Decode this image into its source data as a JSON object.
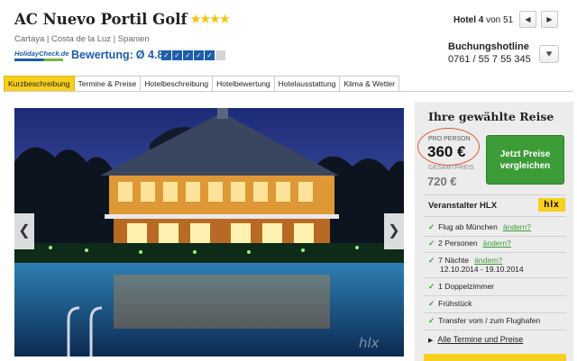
{
  "hotel": {
    "name": "AC Nuevo Portil Golf",
    "stars": "★★★★",
    "location": "Cartaya | Costa de la Luz | Spanien"
  },
  "rating": {
    "logo_text": "HolidayCheck.de",
    "label": "Bewertung:",
    "value": "Ø 4.8",
    "boxes_filled": 5,
    "boxes_total": 6
  },
  "pager": {
    "hotel_label": "Hotel",
    "current": "4",
    "separator": "von",
    "total": "51",
    "prev_icon": "◀",
    "next_icon": "▶"
  },
  "hotline": {
    "label": "Buchungshotline",
    "number": "0761 / 55 7 55 345",
    "favorite_icon": "♥"
  },
  "tabs": [
    {
      "label": "Kurzbeschreibung",
      "active": true
    },
    {
      "label": "Termine & Preise",
      "active": false
    },
    {
      "label": "Hotelbeschreibung",
      "active": false
    },
    {
      "label": "Hotelbewertung",
      "active": false
    },
    {
      "label": "Hotelausstattung",
      "active": false
    },
    {
      "label": "Klima & Wetter",
      "active": false
    }
  ],
  "gallery": {
    "prev_icon": "❮",
    "next_icon": "❯",
    "watermark": "hlx"
  },
  "booking": {
    "title": "Ihre gewählte Reise",
    "per_person_label": "PRO PERSON",
    "per_person_price": "360 €",
    "total_label": "GESAMTPREIS",
    "total_price": "720 €",
    "cta_label_line1": "Jetzt Preise",
    "cta_label_line2": "vergleichen",
    "operator_label": "Veranstalter HLX",
    "operator_logo": "hlx",
    "items": [
      {
        "text": "Flug ab München",
        "link": "ändern?"
      },
      {
        "text": "2 Personen",
        "link": "ändern?"
      },
      {
        "text": "7 Nächte",
        "link": "ändern?",
        "sub": "12.10.2014 - 19.10.2014"
      },
      {
        "text": "1 Doppelzimmer",
        "link": ""
      },
      {
        "text": "Frühstück",
        "link": ""
      },
      {
        "text": "Transfer vom / zum Flughafen",
        "link": ""
      }
    ],
    "more_link": "Alle Termine und Preise"
  },
  "colors": {
    "accent_yellow": "#f7cf1e",
    "green": "#3c9c37",
    "holidaycheck_blue": "#1d5ea8",
    "highlight_circle": "#e8553a"
  }
}
